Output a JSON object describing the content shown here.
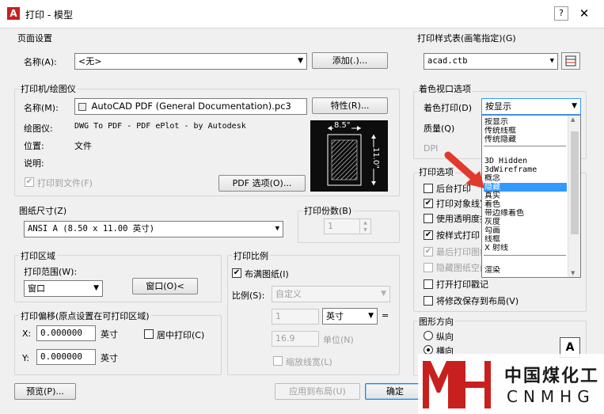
{
  "titlebar": {
    "icon_letter": "A",
    "title": "打印 - 模型",
    "help": "?",
    "close": "✕"
  },
  "page_setup": {
    "group": "页面设置",
    "name_label": "名称(A):",
    "name_value": "<无>",
    "add_button": "添加(.)..."
  },
  "printer": {
    "group": "打印机/绘图仪",
    "name_label": "名称(M):",
    "name_value": "AutoCAD PDF (General Documentation).pc3",
    "properties_button": "特性(R)...",
    "plotter_label": "绘图仪:",
    "plotter_value": "DWG To PDF - PDF ePlot - by Autodesk",
    "location_label": "位置:",
    "location_value": "文件",
    "description_label": "说明:",
    "plot_to_file": "打印到文件(F)",
    "pdf_options_button": "PDF 选项(O)...",
    "preview_width": "8.5\"",
    "preview_height": "11.0\""
  },
  "paper_size": {
    "group": "图纸尺寸(Z)",
    "value": "ANSI A (8.50 x 11.00 英寸)"
  },
  "copies": {
    "group": "打印份数(B)",
    "value": "1"
  },
  "plot_area": {
    "group": "打印区域",
    "range_label": "打印范围(W):",
    "range_value": "窗口",
    "window_button": "窗口(O)<"
  },
  "plot_offset": {
    "group": "打印偏移(原点设置在可打印区域)",
    "x_label": "X:",
    "x_value": "0.000000",
    "x_unit": "英寸",
    "y_label": "Y:",
    "y_value": "0.000000",
    "y_unit": "英寸",
    "center_plot": "居中打印(C)"
  },
  "plot_scale": {
    "group": "打印比例",
    "fit_to_paper": "布满图纸(I)",
    "scale_label": "比例(S):",
    "scale_value": "自定义",
    "inches_value": "1",
    "inches_unit": "英寸",
    "equals": "=",
    "units_value": "16.9",
    "units_label": "单位(N)",
    "scale_lineweights": "缩放线宽(L)"
  },
  "plot_style_table": {
    "group": "打印样式表(画笔指定)(G)",
    "value": "acad.ctb"
  },
  "shaded_viewport": {
    "group": "着色视口选项",
    "shade_plot_label": "着色打印(D)",
    "shade_plot_value": "按显示",
    "quality_label": "质量(Q)",
    "dpi_label": "DPI",
    "dropdown_items": [
      "按显示",
      "传统线框",
      "传统隐藏",
      "3D Hidden",
      "3dWireframe",
      "概念",
      "隐藏",
      "真实",
      "着色",
      "带边缘着色",
      "灰度",
      "勾画",
      "线框",
      "X 射线",
      "渲染"
    ],
    "selected_index": 6
  },
  "plot_options": {
    "group": "打印选项",
    "items": [
      {
        "label": "后台打印",
        "checked": false,
        "enabled": true
      },
      {
        "label": "打印对象线宽",
        "checked": true,
        "enabled": true
      },
      {
        "label": "使用透明度打印",
        "checked": false,
        "enabled": true
      },
      {
        "label": "按样式打印",
        "checked": true,
        "enabled": true
      },
      {
        "label": "最后打印图纸空间",
        "checked": true,
        "enabled": false
      },
      {
        "label": "隐藏图纸空间对象",
        "checked": false,
        "enabled": false
      },
      {
        "label": "打开打印戳记",
        "checked": false,
        "enabled": true
      },
      {
        "label": "将修改保存到布局(V)",
        "checked": false,
        "enabled": true
      }
    ]
  },
  "drawing_orientation": {
    "group": "图形方向",
    "portrait": "纵向",
    "landscape": "横向",
    "selected": "landscape",
    "paper_icon_letter": "A"
  },
  "footer": {
    "preview_button": "预览(P)...",
    "apply_button": "应用到布局(U)",
    "ok_button": "确定"
  },
  "watermark": {
    "chinese": "中国煤化工",
    "english": "CNMHG"
  },
  "colors": {
    "accent_red": "#c8201e",
    "selection_blue": "#3399ff",
    "arrow_red": "#e03a2e"
  }
}
